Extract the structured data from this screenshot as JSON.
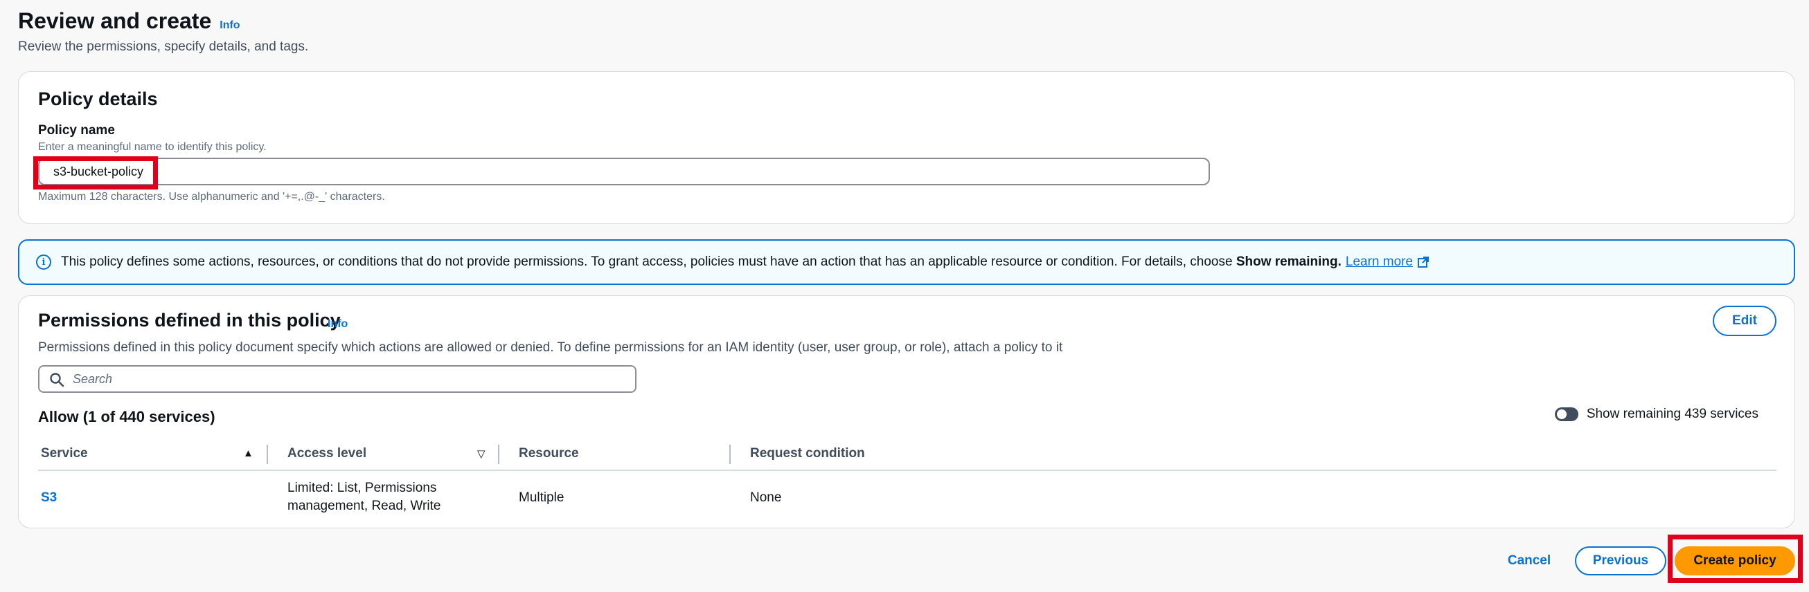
{
  "header": {
    "title": "Review and create",
    "info_label": "Info",
    "subtitle": "Review the permissions, specify details, and tags."
  },
  "policy_details": {
    "heading": "Policy details",
    "name_label": "Policy name",
    "name_description": "Enter a meaningful name to identify this policy.",
    "name_value": "s3-bucket-policy",
    "name_constraint": "Maximum 128 characters. Use alphanumeric and '+=,.@-_' characters."
  },
  "alert": {
    "text": "This policy defines some actions, resources, or conditions that do not provide permissions. To grant access, policies must have an action that has an applicable resource or condition. For details, choose",
    "bold_text": "Show remaining.",
    "link_text": "Learn more"
  },
  "permissions": {
    "heading": "Permissions defined in this policy",
    "info_label": "Info",
    "edit_label": "Edit",
    "description": "Permissions defined in this policy document specify which actions are allowed or denied. To define permissions for an IAM identity (user, user group, or role), attach a policy to it",
    "search_placeholder": "Search",
    "allow_heading": "Allow (1 of 440 services)",
    "toggle_label": "Show remaining 439 services",
    "columns": [
      "Service",
      "Access level",
      "Resource",
      "Request condition"
    ],
    "rows": [
      {
        "service": "S3",
        "access_level_line1": "Limited: List, Permissions",
        "access_level_line2": "management, Read, Write",
        "resource": "Multiple",
        "request_condition": "None"
      }
    ]
  },
  "footer": {
    "cancel_label": "Cancel",
    "previous_label": "Previous",
    "create_label": "Create policy"
  },
  "colors": {
    "accent": "#0972d3",
    "primary_button": "#ff9900",
    "highlight": "#e0001b"
  }
}
